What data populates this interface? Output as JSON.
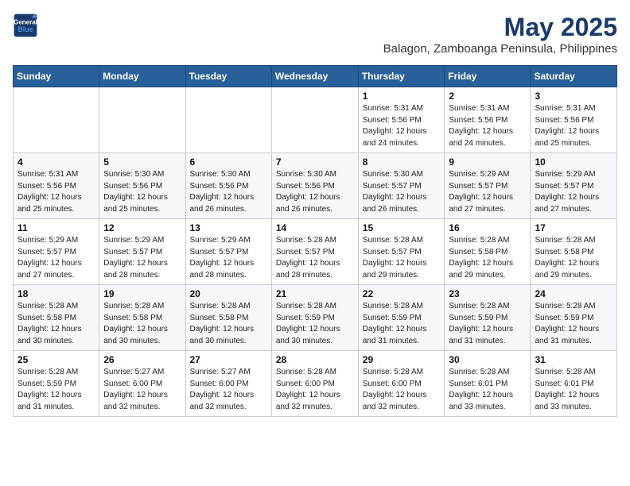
{
  "logo": {
    "line1": "General",
    "line2": "Blue"
  },
  "title": "May 2025",
  "subtitle": "Balagon, Zamboanga Peninsula, Philippines",
  "weekdays": [
    "Sunday",
    "Monday",
    "Tuesday",
    "Wednesday",
    "Thursday",
    "Friday",
    "Saturday"
  ],
  "weeks": [
    [
      {
        "day": "",
        "info": ""
      },
      {
        "day": "",
        "info": ""
      },
      {
        "day": "",
        "info": ""
      },
      {
        "day": "",
        "info": ""
      },
      {
        "day": "1",
        "info": "Sunrise: 5:31 AM\nSunset: 5:56 PM\nDaylight: 12 hours\nand 24 minutes."
      },
      {
        "day": "2",
        "info": "Sunrise: 5:31 AM\nSunset: 5:56 PM\nDaylight: 12 hours\nand 24 minutes."
      },
      {
        "day": "3",
        "info": "Sunrise: 5:31 AM\nSunset: 5:56 PM\nDaylight: 12 hours\nand 25 minutes."
      }
    ],
    [
      {
        "day": "4",
        "info": "Sunrise: 5:31 AM\nSunset: 5:56 PM\nDaylight: 12 hours\nand 25 minutes."
      },
      {
        "day": "5",
        "info": "Sunrise: 5:30 AM\nSunset: 5:56 PM\nDaylight: 12 hours\nand 25 minutes."
      },
      {
        "day": "6",
        "info": "Sunrise: 5:30 AM\nSunset: 5:56 PM\nDaylight: 12 hours\nand 26 minutes."
      },
      {
        "day": "7",
        "info": "Sunrise: 5:30 AM\nSunset: 5:56 PM\nDaylight: 12 hours\nand 26 minutes."
      },
      {
        "day": "8",
        "info": "Sunrise: 5:30 AM\nSunset: 5:57 PM\nDaylight: 12 hours\nand 26 minutes."
      },
      {
        "day": "9",
        "info": "Sunrise: 5:29 AM\nSunset: 5:57 PM\nDaylight: 12 hours\nand 27 minutes."
      },
      {
        "day": "10",
        "info": "Sunrise: 5:29 AM\nSunset: 5:57 PM\nDaylight: 12 hours\nand 27 minutes."
      }
    ],
    [
      {
        "day": "11",
        "info": "Sunrise: 5:29 AM\nSunset: 5:57 PM\nDaylight: 12 hours\nand 27 minutes."
      },
      {
        "day": "12",
        "info": "Sunrise: 5:29 AM\nSunset: 5:57 PM\nDaylight: 12 hours\nand 28 minutes."
      },
      {
        "day": "13",
        "info": "Sunrise: 5:29 AM\nSunset: 5:57 PM\nDaylight: 12 hours\nand 28 minutes."
      },
      {
        "day": "14",
        "info": "Sunrise: 5:28 AM\nSunset: 5:57 PM\nDaylight: 12 hours\nand 28 minutes."
      },
      {
        "day": "15",
        "info": "Sunrise: 5:28 AM\nSunset: 5:57 PM\nDaylight: 12 hours\nand 29 minutes."
      },
      {
        "day": "16",
        "info": "Sunrise: 5:28 AM\nSunset: 5:58 PM\nDaylight: 12 hours\nand 29 minutes."
      },
      {
        "day": "17",
        "info": "Sunrise: 5:28 AM\nSunset: 5:58 PM\nDaylight: 12 hours\nand 29 minutes."
      }
    ],
    [
      {
        "day": "18",
        "info": "Sunrise: 5:28 AM\nSunset: 5:58 PM\nDaylight: 12 hours\nand 30 minutes."
      },
      {
        "day": "19",
        "info": "Sunrise: 5:28 AM\nSunset: 5:58 PM\nDaylight: 12 hours\nand 30 minutes."
      },
      {
        "day": "20",
        "info": "Sunrise: 5:28 AM\nSunset: 5:58 PM\nDaylight: 12 hours\nand 30 minutes."
      },
      {
        "day": "21",
        "info": "Sunrise: 5:28 AM\nSunset: 5:59 PM\nDaylight: 12 hours\nand 30 minutes."
      },
      {
        "day": "22",
        "info": "Sunrise: 5:28 AM\nSunset: 5:59 PM\nDaylight: 12 hours\nand 31 minutes."
      },
      {
        "day": "23",
        "info": "Sunrise: 5:28 AM\nSunset: 5:59 PM\nDaylight: 12 hours\nand 31 minutes."
      },
      {
        "day": "24",
        "info": "Sunrise: 5:28 AM\nSunset: 5:59 PM\nDaylight: 12 hours\nand 31 minutes."
      }
    ],
    [
      {
        "day": "25",
        "info": "Sunrise: 5:28 AM\nSunset: 5:59 PM\nDaylight: 12 hours\nand 31 minutes."
      },
      {
        "day": "26",
        "info": "Sunrise: 5:27 AM\nSunset: 6:00 PM\nDaylight: 12 hours\nand 32 minutes."
      },
      {
        "day": "27",
        "info": "Sunrise: 5:27 AM\nSunset: 6:00 PM\nDaylight: 12 hours\nand 32 minutes."
      },
      {
        "day": "28",
        "info": "Sunrise: 5:28 AM\nSunset: 6:00 PM\nDaylight: 12 hours\nand 32 minutes."
      },
      {
        "day": "29",
        "info": "Sunrise: 5:28 AM\nSunset: 6:00 PM\nDaylight: 12 hours\nand 32 minutes."
      },
      {
        "day": "30",
        "info": "Sunrise: 5:28 AM\nSunset: 6:01 PM\nDaylight: 12 hours\nand 33 minutes."
      },
      {
        "day": "31",
        "info": "Sunrise: 5:28 AM\nSunset: 6:01 PM\nDaylight: 12 hours\nand 33 minutes."
      }
    ]
  ]
}
